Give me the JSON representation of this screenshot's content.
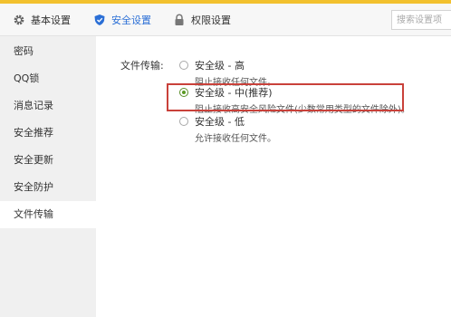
{
  "toolbar": {
    "tabs": [
      {
        "label": "基本设置",
        "icon": "gear-icon"
      },
      {
        "label": "安全设置",
        "icon": "shield-icon"
      },
      {
        "label": "权限设置",
        "icon": "lock-icon"
      }
    ],
    "search_placeholder": "搜索设置项"
  },
  "sidebar": {
    "items": [
      {
        "label": "密码"
      },
      {
        "label": "QQ锁"
      },
      {
        "label": "消息记录"
      },
      {
        "label": "安全推荐"
      },
      {
        "label": "安全更新"
      },
      {
        "label": "安全防护"
      },
      {
        "label": "文件传输"
      }
    ],
    "selected": "文件传输"
  },
  "file_transfer": {
    "label": "文件传输:",
    "options": [
      {
        "title": "安全级 - 高",
        "desc": "阻止接收任何文件。",
        "checked": false
      },
      {
        "title": "安全级 - 中(推荐)",
        "desc": "阻止接收高安全风险文件(少数常用类型的文件除外)。",
        "checked": true
      },
      {
        "title": "安全级 - 低",
        "desc": "允许接收任何文件。",
        "checked": false
      }
    ]
  },
  "colors": {
    "top_strip": "#f2c12e",
    "active_tab_text": "#2b6fd6",
    "highlight_border": "#c9413a",
    "radio_checked": "#5a9a24"
  }
}
